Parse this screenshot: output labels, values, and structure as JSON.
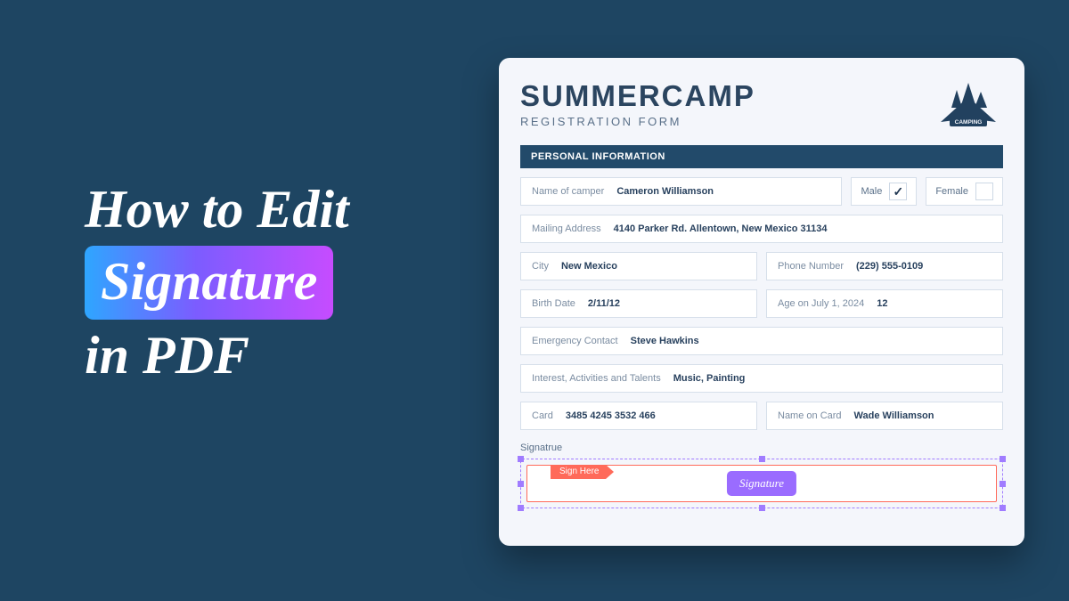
{
  "headline": {
    "l1": "How to Edit",
    "l2": "Signature",
    "l3": "in PDF"
  },
  "form": {
    "title": "SUMMERCAMP",
    "subtitle": "REGISTRATION FORM",
    "section": "PERSONAL INFORMATION",
    "labels": {
      "name": "Name of camper",
      "male": "Male",
      "female": "Female",
      "mail": "Mailing Address",
      "city": "City",
      "phone": "Phone Number",
      "birth": "Birth Date",
      "age": "Age on July 1, 2024",
      "emergency": "Emergency Contact",
      "interests": "Interest, Activities and Talents",
      "card": "Card",
      "cardname": "Name on Card",
      "signature": "Signatrue",
      "signhere": "Sign Here",
      "sigbtn": "Signature"
    },
    "values": {
      "name": "Cameron Williamson",
      "male_checked": "✓",
      "female_checked": "",
      "mail": "4140 Parker Rd. Allentown, New Mexico 31134",
      "city": "New Mexico",
      "phone": "(229) 555-0109",
      "birth": "2/11/12",
      "age": "12",
      "emergency": "Steve Hawkins",
      "interests": "Music, Painting",
      "card": "3485 4245 3532 466",
      "cardname": "Wade Williamson"
    },
    "logo_text": "CAMPING"
  }
}
